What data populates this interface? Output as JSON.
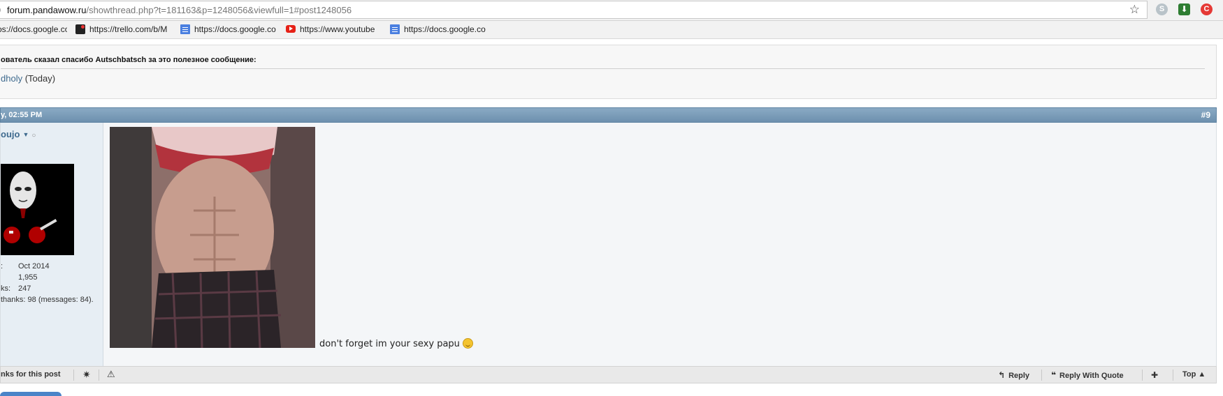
{
  "browser": {
    "url_lead": ")",
    "url_host": "forum.pandawow.ru",
    "url_path": "/showthread.php?t=181163&p=1248056&viewfull=1#post1248056",
    "extensions": [
      "skype-icon",
      "download-icon",
      "red-extension-icon"
    ]
  },
  "bookmarks": [
    {
      "label": "os://docs.google.co",
      "icon": "doc-icon"
    },
    {
      "label": "https://trello.com/b/M",
      "icon": "trello-icon"
    },
    {
      "label": "https://docs.google.co",
      "icon": "doc-icon"
    },
    {
      "label": "https://www.youtube",
      "icon": "youtube-icon"
    },
    {
      "label": "https://docs.google.co",
      "icon": "doc-icon"
    }
  ],
  "thanks": {
    "title": "ователь сказал спасибо Autschbatsch за это полезное сообщение:",
    "user": "dholy",
    "when": "(Today)"
  },
  "post": {
    "date": "y, 02:55 PM",
    "number": "#9",
    "username": "oujo",
    "stats": [
      {
        "label": ":",
        "value": "Oct 2014"
      },
      {
        "label": "",
        "value": "1,955"
      },
      {
        "label": "ks:",
        "value": "247"
      },
      {
        "label": "thanks: 98 (messages: 84).",
        "value": ""
      }
    ],
    "text": "don't forget im your sexy papu"
  },
  "footer": {
    "thanks_label": "nks for this post",
    "reply": "Reply",
    "reply_quote": "Reply With Quote",
    "top": "Top"
  }
}
